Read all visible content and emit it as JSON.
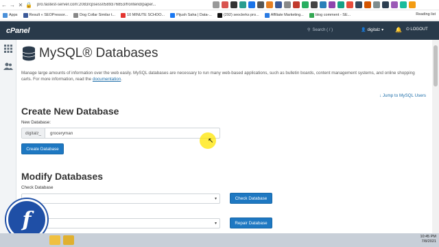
{
  "browser": {
    "url": "pro.fastest-server.com:2083/cpsess0589376853/frontend/paper...",
    "bookmarks": [
      {
        "label": "Apps",
        "color": "#4a90d9"
      },
      {
        "label": "Result « SEOPressor...",
        "color": "#3b5998"
      },
      {
        "label": "Dog Collar Similar t...",
        "color": "#888888"
      },
      {
        "label": "10 MINUTE SCHOO...",
        "color": "#e3342f"
      },
      {
        "label": "Pijush Saha | Data-...",
        "color": "#1877f2"
      },
      {
        "label": "(292) seoclerks pro...",
        "color": "#111111"
      },
      {
        "label": "Affiliate Marketing...",
        "color": "#2a7ae2"
      },
      {
        "label": "blog comment - SE...",
        "color": "#34a853"
      }
    ],
    "reading_list": "Reading list"
  },
  "header": {
    "logo": "cPanel",
    "search_placeholder": "Search ( / )",
    "username": "digitalz",
    "logout": "LOGOUT"
  },
  "page": {
    "title": "MySQL® Databases",
    "description": "Manage large amounts of information over the web easily. MySQL databases are necessary to run many web-based applications, such as bulletin boards, content management systems, and online shopping carts. For more information, read the ",
    "doc_link": "documentation",
    "description_end": ".",
    "jump_link": "Jump to MySQL Users"
  },
  "create": {
    "heading": "Create New Database",
    "label": "New Database:",
    "prefix": "digitalz_",
    "value": "groceryman",
    "button": "Create Database"
  },
  "modify": {
    "heading": "Modify Databases",
    "check_label": "Check Database",
    "check_button": "Check Database",
    "repair_label": "abase",
    "repair_button": "Repair Database"
  },
  "tray": {
    "time": "10:45 PM",
    "date": "7/8/2021"
  },
  "colors": {
    "header_bg": "#293a4a",
    "button": "#1e78c2",
    "link": "#1a6ca8"
  }
}
